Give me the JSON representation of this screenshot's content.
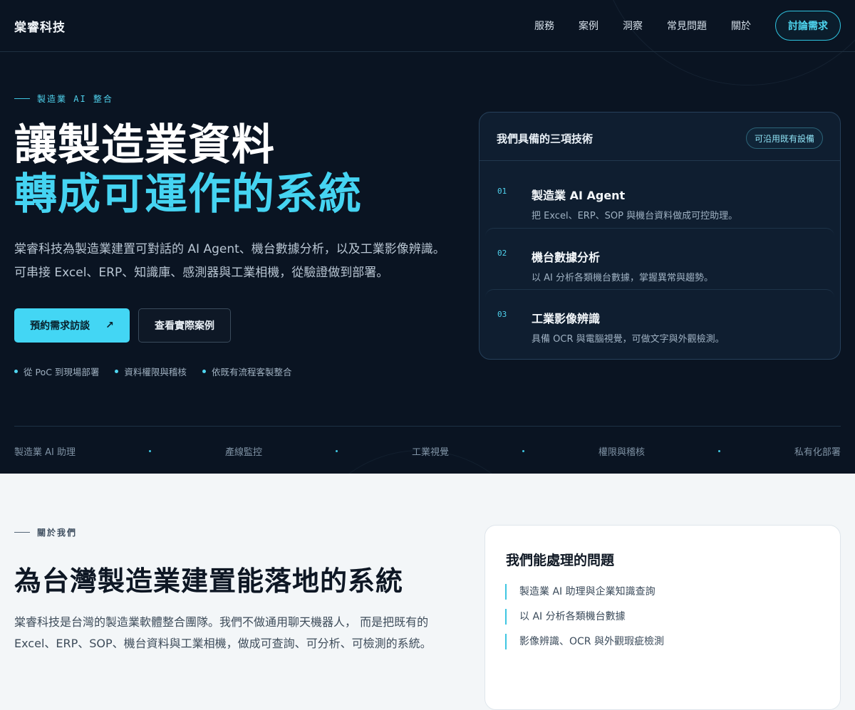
{
  "nav": {
    "brand": "棠睿科技",
    "links": [
      "服務",
      "案例",
      "洞察",
      "常見問題",
      "關於"
    ],
    "cta": "討論需求"
  },
  "hero": {
    "eyebrow": "製造業 AI 整合",
    "title_line1": "讓製造業資料",
    "title_line2": "轉成可運作的系統",
    "lede": "棠睿科技為製造業建置可對話的 AI Agent、機台數據分析，以及工業影像辨識。 可串接 Excel、ERP、知識庫、感測器與工業相機，從驗證做到部署。",
    "primary_button": "預約需求訪談",
    "primary_arrow": "↗",
    "secondary_button": "查看實際案例",
    "bullets": [
      "從 PoC 到現場部署",
      "資料權限與稽核",
      "依既有流程客製整合"
    ]
  },
  "tech_card": {
    "title": "我們具備的三項技術",
    "badge": "可沿用既有設備",
    "items": [
      {
        "num": "01",
        "name": "製造業 AI Agent",
        "desc": "把 Excel、ERP、SOP 與機台資料做成可控助理。"
      },
      {
        "num": "02",
        "name": "機台數據分析",
        "desc": "以 AI 分析各類機台數據，掌握異常與趨勢。"
      },
      {
        "num": "03",
        "name": "工業影像辨識",
        "desc": "具備 OCR 與電腦視覺，可做文字與外觀檢測。"
      }
    ]
  },
  "ticker": [
    "製造業 AI 助理",
    "產線監控",
    "工業視覺",
    "權限與稽核",
    "私有化部署"
  ],
  "about": {
    "eyebrow": "關於我們",
    "title": "為台灣製造業建置能落地的系統",
    "body": "棠睿科技是台灣的製造業軟體整合團隊。我們不做通用聊天機器人， 而是把既有的 Excel、ERP、SOP、機台資料與工業相機，做成可查詢、可分析、可檢測的系統。"
  },
  "issues": {
    "title": "我們能處理的問題",
    "items": [
      "製造業 AI 助理與企業知識查詢",
      "以 AI 分析各類機台數據",
      "影像辨識、OCR 與外觀瑕疵檢測"
    ]
  }
}
